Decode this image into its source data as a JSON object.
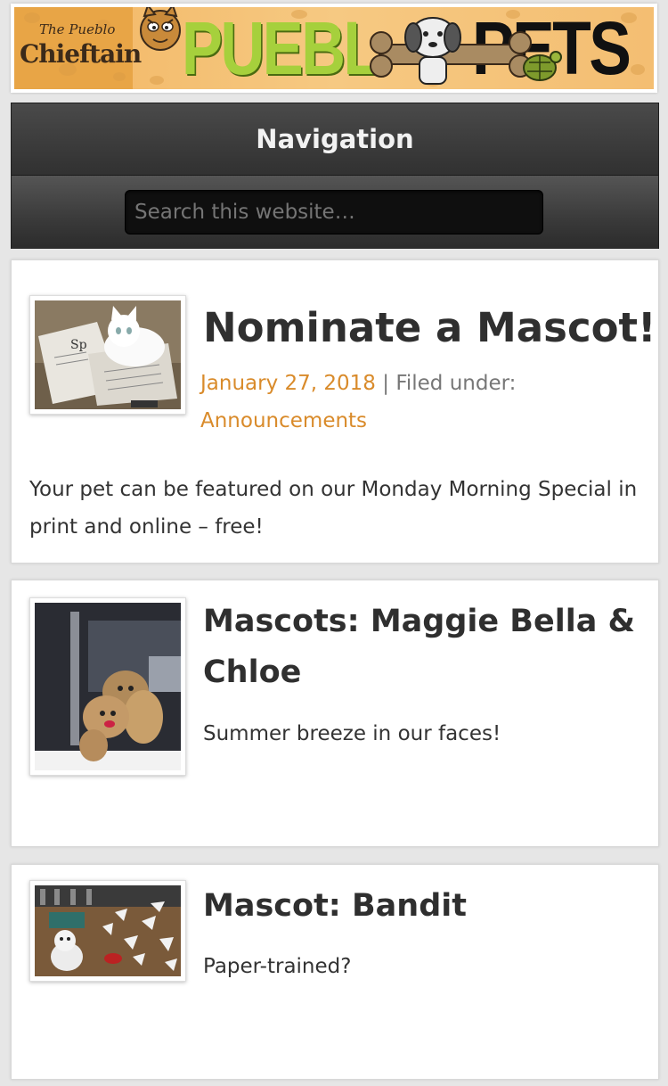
{
  "header": {
    "banner_chieftain_top": "The Pueblo",
    "banner_chieftain_main": "Chieftain",
    "banner_logo_left": "PUEBL",
    "banner_logo_right": "PETS"
  },
  "navigation": {
    "title": "Navigation",
    "search_placeholder": "Search this website…"
  },
  "posts": [
    {
      "title": "Nominate a Mascot!",
      "date": "January 27, 2018",
      "separator": "|",
      "filed_label": "Filed under:",
      "category": "Announcements",
      "excerpt": "Your pet can be featured on our Monday Morning Special in print and online – free!"
    },
    {
      "title": "Mascots: Maggie Bella & Chloe",
      "excerpt": "Summer breeze in our faces!"
    },
    {
      "title": "Mascot: Bandit",
      "excerpt": "Paper-trained?"
    }
  ],
  "colors": {
    "accent_link": "#d98b2b",
    "nav_background": "#333333",
    "logo_green": "#a6d03c"
  },
  "icons": [
    "tiger-icon",
    "dog-bone-icon",
    "turtle-icon"
  ]
}
